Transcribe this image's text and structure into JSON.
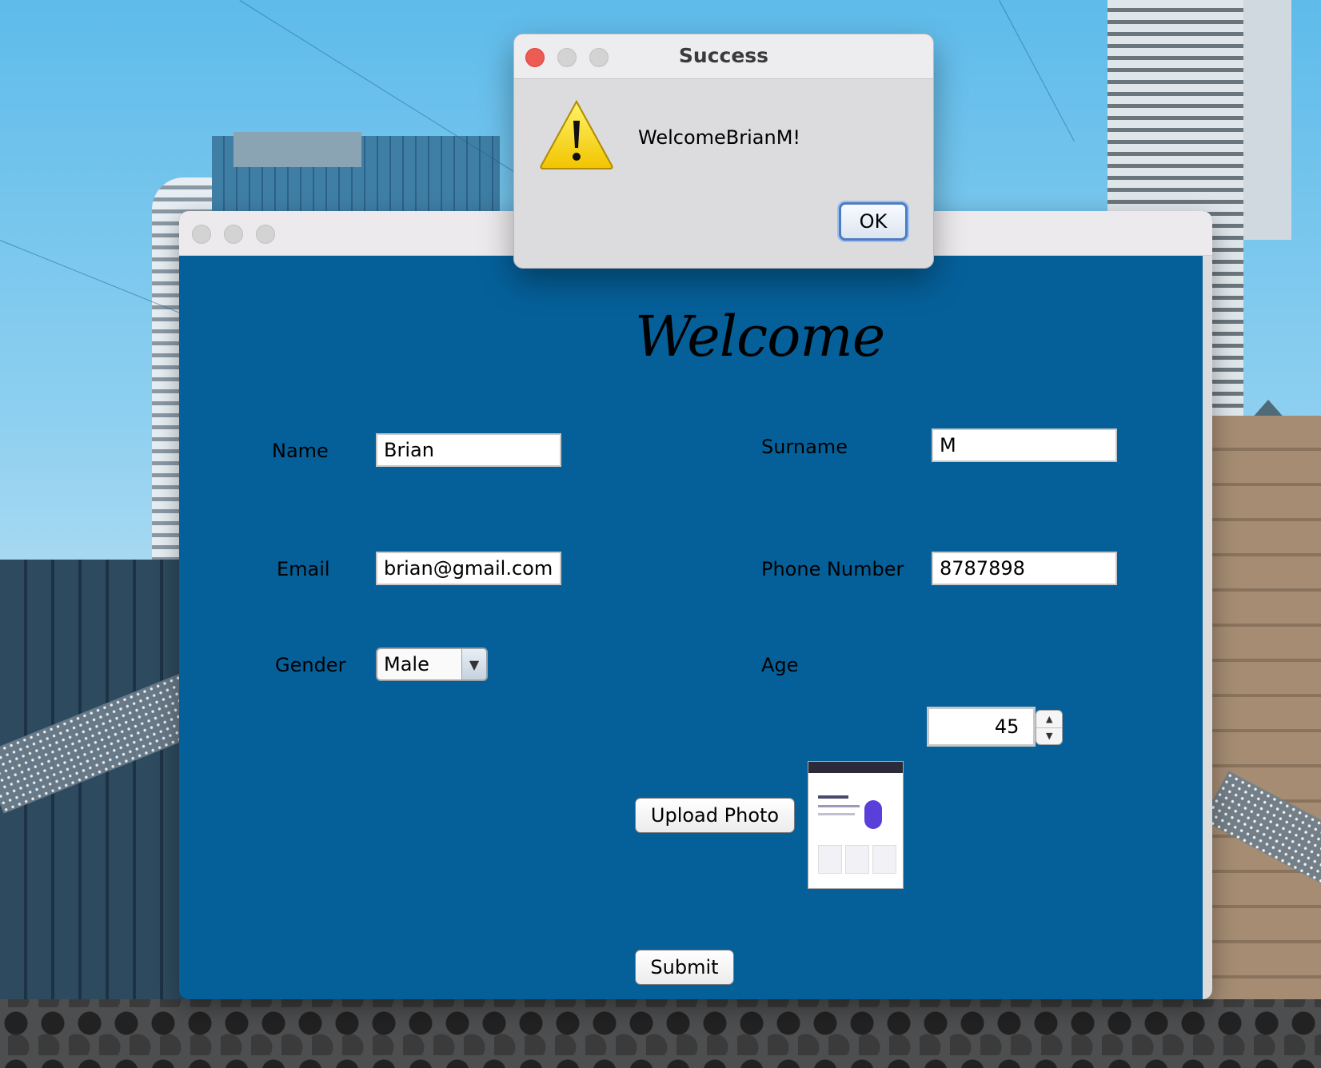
{
  "dialog": {
    "title": "Success",
    "message": "WelcomeBrianM!",
    "ok_label": "OK",
    "icon": "warning-icon"
  },
  "form": {
    "heading": "Welcome",
    "name_label": "Name",
    "name_value": "Brian",
    "surname_label": "Surname",
    "surname_value": "M",
    "email_label": "Email",
    "email_value": "brian@gmail.com",
    "phone_label": "Phone Number",
    "phone_value": "8787898",
    "gender_label": "Gender",
    "gender_value": "Male",
    "age_label": "Age",
    "age_value": "45",
    "upload_label": "Upload Photo",
    "submit_label": "Submit"
  },
  "colors": {
    "form_background": "#05609a",
    "close_button": "#ee5b53",
    "ok_button_focus": "#4d7cc2"
  }
}
